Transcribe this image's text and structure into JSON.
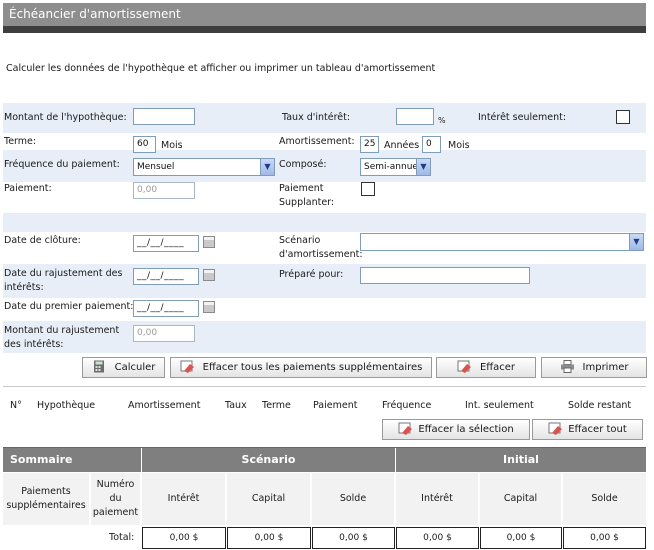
{
  "title": "Échéancier d'amortissement",
  "subtitle": "Calculer les données de l'hypothèque et afficher ou imprimer un tableau d'amortissement",
  "form": {
    "mortgage_amount_label": "Montant de l'hypothèque:",
    "mortgage_amount_value": "",
    "interest_rate_label": "Taux d'intérêt:",
    "interest_rate_value": "",
    "percent_sign": "%",
    "interest_only_label": "Intérêt seulement:",
    "term_label": "Terme:",
    "term_value": "60",
    "term_unit": "Mois",
    "amortization_label": "Amortissement:",
    "amortization_years": "25",
    "years_unit": "Années",
    "amortization_months": "0",
    "months_unit": "Mois",
    "payment_frequency_label": "Fréquence du paiement:",
    "payment_frequency_value": "Mensuel",
    "compounded_label": "Composé:",
    "compounded_value": "Semi-annuel",
    "payment_label": "Paiement:",
    "payment_value": "0,00",
    "payment_override_label": "Paiement Supplanter:",
    "closing_date_label": "Date de clôture:",
    "date_placeholder": "__/__/____",
    "scenario_label": "Scénario d'amortissement:",
    "scenario_value": "",
    "interest_adjustment_date_label": "Date du rajustement des intérêts:",
    "prepared_for_label": "Préparé pour:",
    "prepared_for_value": "",
    "first_payment_date_label": "Date du premier paiement:",
    "interest_adjustment_amount_label": "Montant du rajustement des intérêts:",
    "interest_adjustment_amount_value": "0,00"
  },
  "buttons": {
    "calculate": "Calculer",
    "clear_extra_payments": "Effacer tous les paiements supplémentaires",
    "clear": "Effacer",
    "print": "Imprimer",
    "clear_selection": "Effacer la sélection",
    "clear_all": "Effacer tout"
  },
  "scenario_table": {
    "columns": [
      "N°",
      "Hypothèque",
      "Amortissement",
      "Taux",
      "Terme",
      "Paiement",
      "Fréquence",
      "Int. seulement",
      "Solde restant"
    ]
  },
  "summary": {
    "title": "Sommaire",
    "scenario_group": "Scénario",
    "initial_group": "Initial",
    "extra_payments": "Paiements supplémentaires",
    "payment_number": "Numéro du paiement",
    "interest": "Intérêt",
    "capital": "Capital",
    "balance": "Solde",
    "total_label": "Total:",
    "totals": [
      "0,00 $",
      "0,00 $",
      "0,00 $",
      "0,00 $",
      "0,00 $",
      "0,00 $"
    ]
  },
  "colors": {
    "title_bar": "#8e8e8e",
    "title_rule": "#3e3e3e",
    "form_band": "#e8eef7",
    "summary_header": "#7f7f7f"
  }
}
